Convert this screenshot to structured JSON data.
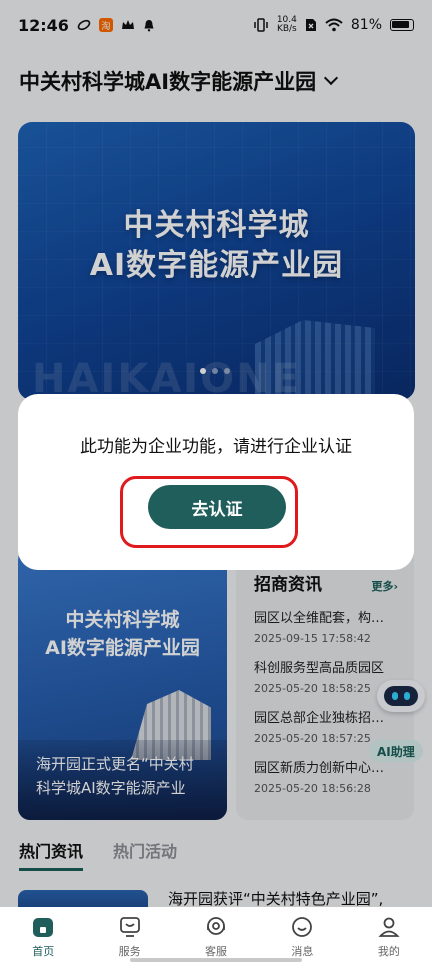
{
  "status_bar": {
    "time": "12:46",
    "net_speed_value": "10.4",
    "net_speed_unit": "KB/s",
    "battery": "81%"
  },
  "header": {
    "park_name": "中关村科学城AI数字能源产业园"
  },
  "banner": {
    "title_line1": "中关村科学城",
    "title_line2": "AI数字能源产业园",
    "watermark": "HAIKAIONE"
  },
  "news_card": {
    "title_line1": "中关村科学城",
    "title_line2": "AI数字能源产业园",
    "caption_line1": "海开园正式更名“中关村",
    "caption_line2": "科学城AI数字能源产业"
  },
  "investment": {
    "title": "招商资讯",
    "more_label": "更多",
    "items": [
      {
        "title": "园区以全维配套，构…",
        "date": "2025-09-15 17:58:42"
      },
      {
        "title": "科创服务型高品质园区",
        "date": "2025-05-20 18:58:25"
      },
      {
        "title": "园区总部企业独栋招…",
        "date": "2025-05-20 18:57:25"
      },
      {
        "title": "园区新质力创新中心…",
        "date": "2025-05-20 18:56:28"
      }
    ]
  },
  "ai_assistant": {
    "label": "AI助理"
  },
  "tabs": [
    {
      "label": "热门资讯"
    },
    {
      "label": "热门活动"
    }
  ],
  "hot_news": {
    "first_title": "海开园获评“中关村特色产业园”,"
  },
  "dialog": {
    "message": "此功能为企业功能，请进行企业认证",
    "button_label": "去认证"
  },
  "bottom_nav": [
    {
      "label": "首页",
      "icon": "home-icon"
    },
    {
      "label": "服务",
      "icon": "service-icon"
    },
    {
      "label": "客服",
      "icon": "customer-service-icon"
    },
    {
      "label": "消息",
      "icon": "message-icon"
    },
    {
      "label": "我的",
      "icon": "profile-icon"
    }
  ],
  "colors": {
    "accent": "#1f5e5b",
    "highlight_ring": "#e0191c"
  }
}
